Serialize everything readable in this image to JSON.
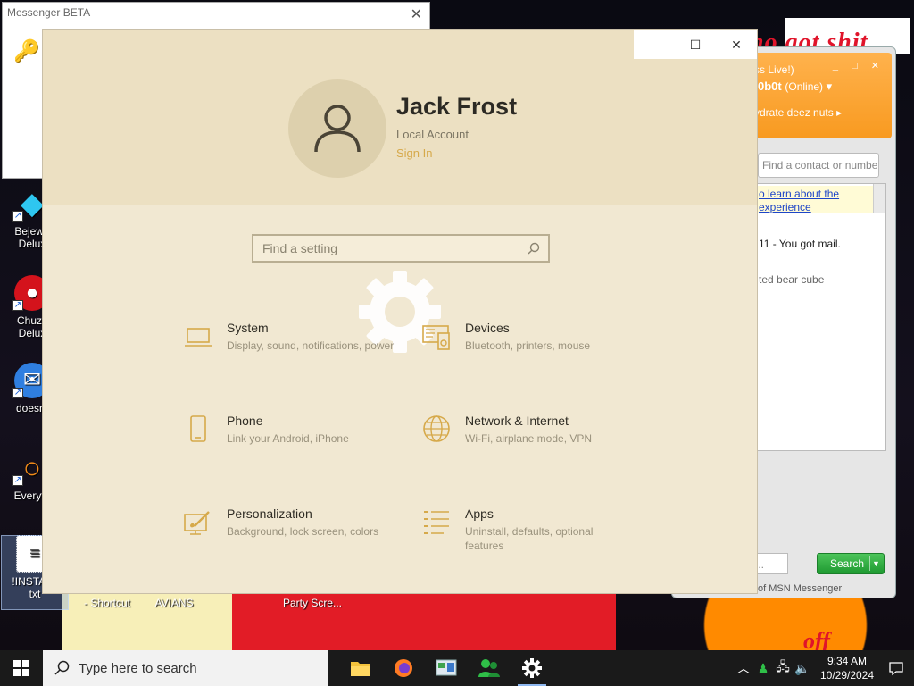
{
  "desktop": {
    "graffiti": "no got shit",
    "graffiti2": "off",
    "icons": [
      {
        "label": "Bejeweled Deluxe",
        "short": "Bejewe\nDelux"
      },
      {
        "label": "Chuzzle Deluxe",
        "short": "Chuzz\nDelux"
      },
      {
        "label": "doesnt",
        "short": "doesnt"
      },
      {
        "label": "Everything",
        "short": "Everyth"
      },
      {
        "label": "!INSTALL txt",
        "short": "!INSTALL\ntxt"
      }
    ],
    "bottom_labels": [
      "- Shortcut",
      "AVIANS",
      "Party Scre..."
    ]
  },
  "messenger_beta": {
    "title": "Messenger BETA"
  },
  "msn": {
    "header_line1": "ss Live!)",
    "user": "0b0t",
    "status": "(Online)",
    "personal_message": "ydrate deez nuts",
    "search_placeholder": "Find a contact or numbe",
    "ad_text": "o learn about the experience",
    "mail_text": "11 - You got mail.",
    "item_text": "ted bear cube",
    "search_button": "Search",
    "footer": "of MSN Messenger"
  },
  "settings": {
    "window_controls": {
      "minimize": "—",
      "maximize": "☐",
      "close": "✕"
    },
    "user_name": "Jack Frost",
    "account_type": "Local Account",
    "sign_in": "Sign In",
    "search_placeholder": "Find a setting",
    "tiles": [
      {
        "title": "System",
        "desc": "Display, sound, notifications, power",
        "icon": "laptop-icon"
      },
      {
        "title": "Devices",
        "desc": "Bluetooth, printers, mouse",
        "icon": "devices-icon"
      },
      {
        "title": "Phone",
        "desc": "Link your Android, iPhone",
        "icon": "phone-icon"
      },
      {
        "title": "Network & Internet",
        "desc": "Wi-Fi, airplane mode, VPN",
        "icon": "globe-icon"
      },
      {
        "title": "Personalization",
        "desc": "Background, lock screen, colors",
        "icon": "paint-icon"
      },
      {
        "title": "Apps",
        "desc": "Uninstall, defaults, optional features",
        "icon": "apps-list-icon"
      }
    ]
  },
  "taskbar": {
    "search_placeholder": "Type here to search",
    "apps": [
      "file-explorer",
      "firefox",
      "control-panel",
      "msn-messenger",
      "settings"
    ],
    "time": "9:34 AM",
    "date": "10/29/2024"
  },
  "colors": {
    "settings_bg": "#f1e8d2",
    "accent": "#d6a94a",
    "taskbar": "#1a1a1a",
    "msn_orange": "#f89a20",
    "msn_green": "#1f9a31"
  }
}
